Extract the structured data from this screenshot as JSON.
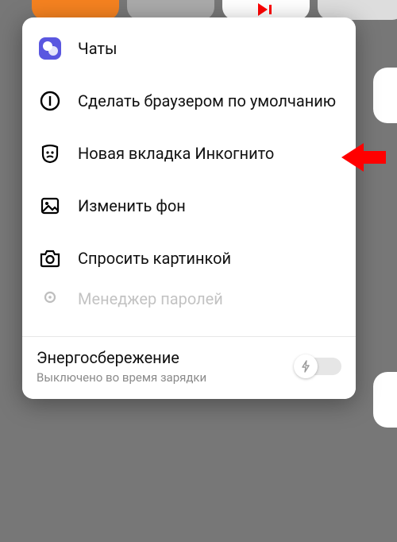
{
  "menu": {
    "items": [
      {
        "label": "Чаты"
      },
      {
        "label": "Сделать браузером по умолчанию"
      },
      {
        "label": "Новая вкладка Инкогнито"
      },
      {
        "label": "Изменить фон"
      },
      {
        "label": "Спросить картинкой"
      },
      {
        "label": "Менеджер паролей"
      }
    ]
  },
  "footer": {
    "title": "Энергосбережение",
    "subtitle": "Выключено во время зарядки",
    "toggle_on": false
  },
  "colors": {
    "callout_arrow": "#ff0000",
    "chats_icon_bg": "#5a57e0"
  }
}
